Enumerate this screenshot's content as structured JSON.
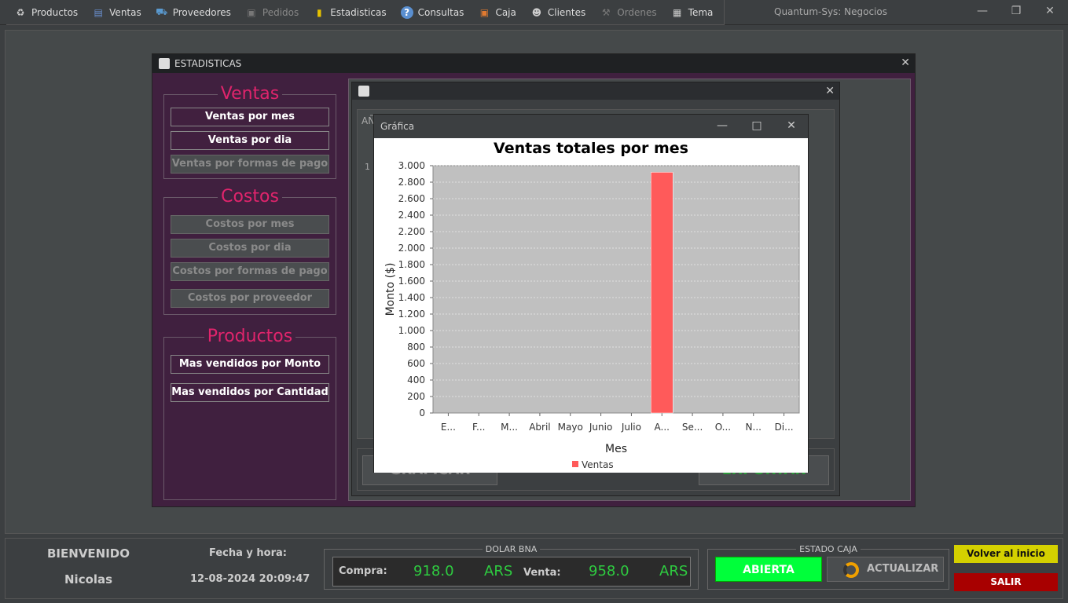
{
  "menubar": {
    "items": [
      {
        "label": "Productos",
        "icon": "bottle-icon",
        "disabled": false
      },
      {
        "label": "Ventas",
        "icon": "register-icon",
        "disabled": false
      },
      {
        "label": "Proveedores",
        "icon": "truck-icon",
        "disabled": false
      },
      {
        "label": "Pedidos",
        "icon": "boxes-icon",
        "disabled": true
      },
      {
        "label": "Estadisticas",
        "icon": "bar-chart-icon",
        "disabled": false
      },
      {
        "label": "Consultas",
        "icon": "help-icon",
        "disabled": false
      },
      {
        "label": "Caja",
        "icon": "safe-icon",
        "disabled": false
      },
      {
        "label": "Clientes",
        "icon": "people-icon",
        "disabled": false
      },
      {
        "label": "Ordenes",
        "icon": "hammer-icon",
        "disabled": true
      },
      {
        "label": "Tema",
        "icon": "theme-icon",
        "disabled": false
      }
    ],
    "app_title": "Quantum-Sys: Negocios"
  },
  "estadisticas": {
    "title": "ESTADISTICAS",
    "ventas": {
      "title": "Ventas",
      "buttons": [
        "Ventas por mes",
        "Ventas por dia",
        "Ventas por formas de pago"
      ]
    },
    "costos": {
      "title": "Costos",
      "buttons": [
        "Costos por mes",
        "Costos por dia",
        "Costos por formas de pago",
        "Costos por proveedor"
      ]
    },
    "productos": {
      "title": "Productos",
      "buttons": [
        "Mas vendidos por Monto",
        "Mas vendidos por Cantidad"
      ]
    },
    "inner": {
      "label_anio": "AÑ",
      "row_num": "1",
      "graficar": "GRAFICAR",
      "exportar": "EXPORTAR"
    }
  },
  "grafica": {
    "window_title": "Gráfica"
  },
  "chart_data": {
    "type": "bar",
    "title": "Ventas totales por mes",
    "xlabel": "Mes",
    "ylabel": "Monto ($)",
    "categories": [
      "E...",
      "F...",
      "M...",
      "Abril",
      "Mayo",
      "Junio",
      "Julio",
      "A...",
      "Se...",
      "O...",
      "N...",
      "Di..."
    ],
    "series": [
      {
        "name": "Ventas",
        "values": [
          0,
          0,
          0,
          0,
          0,
          0,
          0,
          2920,
          0,
          0,
          0,
          0
        ],
        "color": "#ff5a5a"
      }
    ],
    "ylim": [
      0,
      3000
    ],
    "yticks": [
      "0",
      "200",
      "400",
      "600",
      "800",
      "1.000",
      "1.200",
      "1.400",
      "1.600",
      "1.800",
      "2.000",
      "2.200",
      "2.400",
      "2.600",
      "2.800",
      "3.000"
    ],
    "grid": true,
    "legend": "bottom"
  },
  "status": {
    "bienvenido": "BIENVENIDO",
    "user": "Nicolas",
    "fecha_label": "Fecha y hora:",
    "fecha_value": "12-08-2024 20:09:47",
    "dolar_title": "DOLAR BNA",
    "compra_label": "Compra:",
    "compra_value": "918.0",
    "compra_currency": "ARS",
    "venta_label": "Venta:",
    "venta_value": "958.0",
    "venta_currency": "ARS",
    "caja_title": "ESTADO CAJA",
    "caja_estado": "ABIERTA",
    "actualizar": "ACTUALIZAR",
    "volver": "Volver al inicio",
    "salir": "SALIR"
  }
}
